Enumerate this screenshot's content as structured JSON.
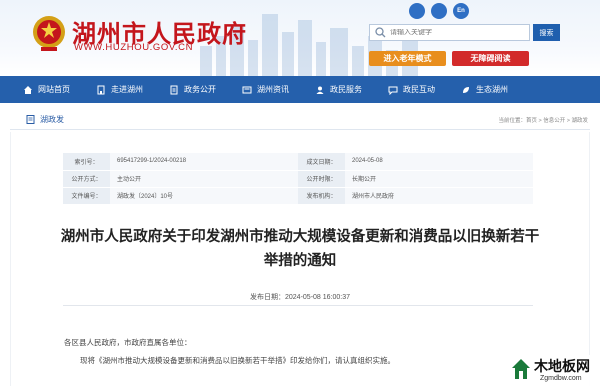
{
  "header": {
    "site_title": "湖州市人民政府",
    "site_domain": "WWW.HUZHOU.GOV.CN",
    "top_icons": [
      "wechat-icon",
      "weibo-icon",
      "english-icon"
    ],
    "top_icon_labels": [
      "",
      "",
      "En"
    ],
    "search": {
      "placeholder": "请输入关键字",
      "button_label": "搜索"
    },
    "elder_mode_label": "进入老年模式",
    "accessibility_label": "无障碍阅读"
  },
  "nav": {
    "items": [
      {
        "label": "网站首页",
        "icon": "home-icon"
      },
      {
        "label": "走进湖州",
        "icon": "building-icon"
      },
      {
        "label": "政务公开",
        "icon": "document-icon"
      },
      {
        "label": "湖州资讯",
        "icon": "news-icon"
      },
      {
        "label": "政民服务",
        "icon": "service-icon"
      },
      {
        "label": "政民互动",
        "icon": "chat-icon"
      },
      {
        "label": "生态湖州",
        "icon": "leaf-icon"
      }
    ]
  },
  "breadcrumb": {
    "title": "湖政发",
    "path": "当前位置：首页 > 信息公开 > 湖政发"
  },
  "meta": {
    "rows": [
      {
        "label1": "索引号：",
        "value1": "695417299-1/2024-00218",
        "label2": "成文日期：",
        "value2": "2024-05-08"
      },
      {
        "label1": "公开方式：",
        "value1": "主动公开",
        "label2": "公开时限：",
        "value2": "长期公开"
      },
      {
        "label1": "文件编号：",
        "value1": "湖政发〔2024〕10号",
        "label2": "发布机构：",
        "value2": "湖州市人民政府"
      }
    ]
  },
  "document": {
    "title_line1": "湖州市人民政府关于印发湖州市推动大规模设备更新和消费品以旧换新若干",
    "title_line2": "举措的通知",
    "publish_time": "发布日期：2024-05-08 16:00:37",
    "salutation": "各区县人民政府，市政府直属各单位：",
    "body": "现将《湖州市推动大规模设备更新和消费品以旧换新若干举措》印发给你们，请认真组织实施。"
  },
  "watermark": {
    "text": "木地板网",
    "url": "Zgmdbw.com"
  },
  "colors": {
    "brand_red": "#c4161c",
    "nav_blue": "#2560ac",
    "elder_orange": "#e88e1d",
    "access_red": "#d22a2a"
  }
}
